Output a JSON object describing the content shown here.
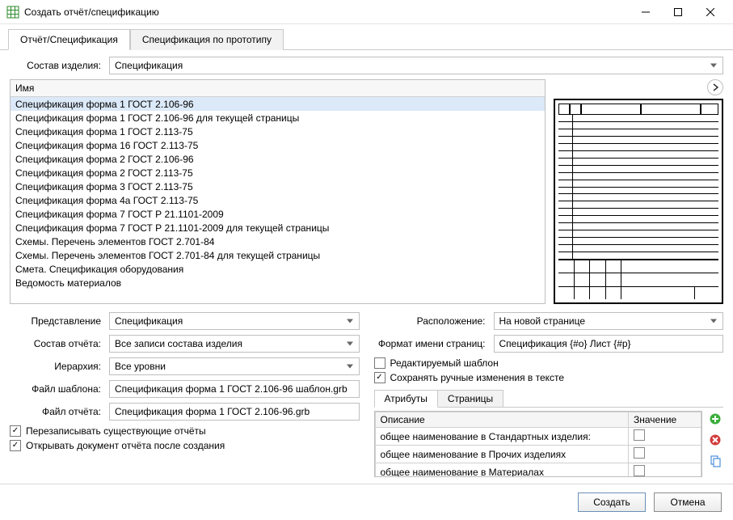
{
  "window": {
    "title": "Создать отчёт/спецификацию"
  },
  "tabs": {
    "report": "Отчёт/Спецификация",
    "prototype": "Спецификация по прототипу"
  },
  "product_structure": {
    "label": "Состав изделия:",
    "value": "Спецификация"
  },
  "list": {
    "header": "Имя",
    "items": [
      "Спецификация форма 1 ГОСТ 2.106-96",
      "Спецификация форма 1 ГОСТ 2.106-96 для текущей страницы",
      "Спецификация форма 1 ГОСТ 2.113-75",
      "Спецификация форма 16 ГОСТ 2.113-75",
      "Спецификация форма 2 ГОСТ 2.106-96",
      "Спецификация форма 2 ГОСТ 2.113-75",
      "Спецификация форма 3 ГОСТ 2.113-75",
      "Спецификация форма 4а ГОСТ 2.113-75",
      "Спецификация форма 7 ГОСТ  Р 21.1101-2009",
      "Спецификация форма 7 ГОСТ  Р 21.1101-2009 для текущей страницы",
      "Схемы. Перечень элементов ГОСТ 2.701-84",
      "Схемы. Перечень элементов ГОСТ 2.701-84 для текущей страницы",
      "Смета. Спецификация оборудования",
      "Ведомость материалов"
    ],
    "selected_index": 0
  },
  "left_form": {
    "view_label": "Представление",
    "view_value": "Спецификация",
    "composition_label": "Состав отчёта:",
    "composition_value": "Все записи состава изделия",
    "hierarchy_label": "Иерархия:",
    "hierarchy_value": "Все уровни",
    "template_label": "Файл шаблона:",
    "template_value": "Спецификация форма 1 ГОСТ 2.106-96 шаблон.grb",
    "report_file_label": "Файл отчёта:",
    "report_file_value": "Спецификация форма 1 ГОСТ 2.106-96.grb",
    "overwrite": "Перезаписывать существующие отчёты",
    "open_after": "Открывать документ отчёта после создания"
  },
  "right_form": {
    "placement_label": "Расположение:",
    "placement_value": "На новой странице",
    "page_name_label": "Формат имени страниц:",
    "page_name_value": "Спецификация {#o} Лист {#p}",
    "editable_template": "Редактируемый шаблон",
    "keep_manual": "Сохранять ручные изменения в тексте",
    "subtab_attributes": "Атрибуты",
    "subtab_pages": "Страницы",
    "attr": {
      "col_desc": "Описание",
      "col_val": "Значение",
      "rows": [
        "общее наименование в Стандартных изделия:",
        "общее наименование в Прочих изделиях",
        "общее наименование в Материалах"
      ]
    }
  },
  "buttons": {
    "create": "Создать",
    "cancel": "Отмена"
  }
}
